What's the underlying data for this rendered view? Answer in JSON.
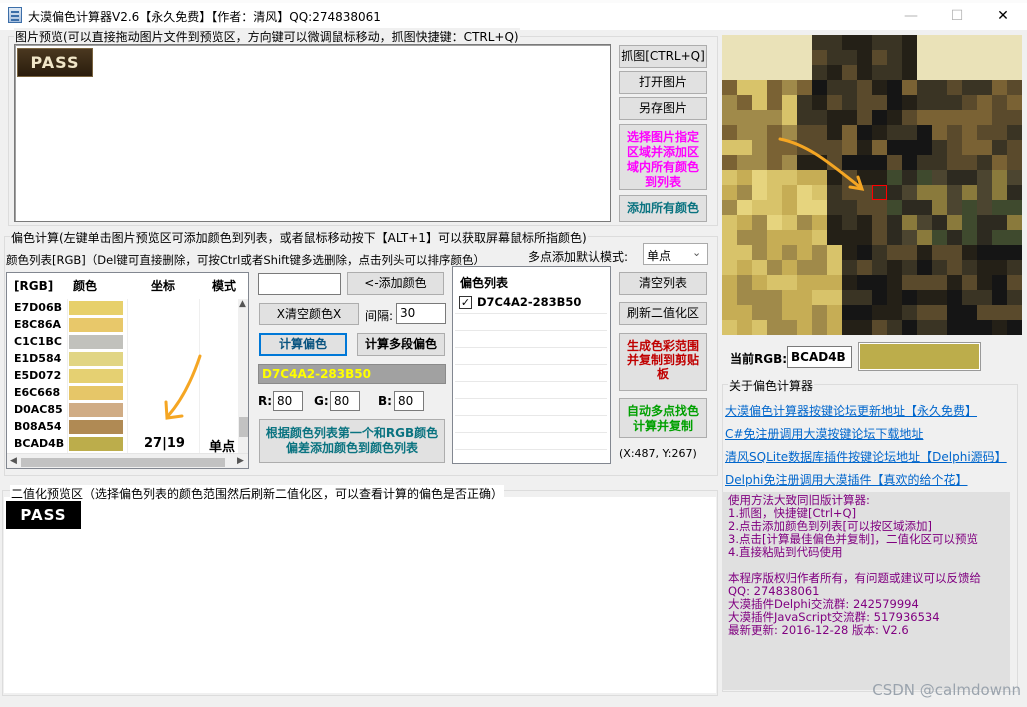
{
  "window": {
    "title": "大漠偏色计算器V2.6【永久免费】【作者：清风】QQ:274838061",
    "min_icon": "—",
    "max_icon": "☐",
    "close_icon": "✕"
  },
  "preview": {
    "group_label": "图片预览(可以直接拖动图片文件到预览区，方向键可以微调鼠标移动，抓图快捷键：CTRL+Q)",
    "image_text": "PASS"
  },
  "right_buttons": {
    "capture": "抓图[CTRL+Q]",
    "open": "打开图片",
    "save_as": "另存图片",
    "select_region": "选择图片指定区域并添加区域内所有颜色到列表",
    "add_all": "添加所有颜色"
  },
  "calc": {
    "group_label": "偏色计算(左键单击图片预览区可添加颜色到列表，或者鼠标移动按下【ALT+1】可以获取屏幕鼠标所指颜色)",
    "list_label": "颜色列表[RGB]（Del键可直接删除，可按Ctrl或者Shift键多选删除，点击列头可以排序颜色）",
    "multi_mode_label": "多点添加默认模式:",
    "multi_mode_value": "单点",
    "columns": [
      "[RGB]",
      "颜色",
      "坐标",
      "模式"
    ],
    "rows": [
      {
        "code": "E7D06B",
        "color": "#e7d06b",
        "coord": "",
        "mode": ""
      },
      {
        "code": "E8C86A",
        "color": "#e8c86a",
        "coord": "",
        "mode": ""
      },
      {
        "code": "C1C1BC",
        "color": "#c1c1bc",
        "coord": "",
        "mode": ""
      },
      {
        "code": "E1D584",
        "color": "#e1d584",
        "coord": "",
        "mode": ""
      },
      {
        "code": "E5D072",
        "color": "#e5d072",
        "coord": "",
        "mode": ""
      },
      {
        "code": "E6C668",
        "color": "#e6c668",
        "coord": "",
        "mode": ""
      },
      {
        "code": "D0AC85",
        "color": "#d0ac85",
        "coord": "",
        "mode": ""
      },
      {
        "code": "B08A54",
        "color": "#b08a54",
        "coord": "",
        "mode": ""
      },
      {
        "code": "BCAD4B",
        "color": "#bcad4b",
        "coord": "27|19",
        "mode": "单点"
      }
    ],
    "add_color_input": "",
    "add_color_btn": "<-添加颜色",
    "clear_color_btn": "X清空颜色X",
    "interval_label": "间隔:",
    "interval_value": "30",
    "calc_btn": "计算偏色",
    "calc_multi_btn": "计算多段偏色",
    "result_value": "D7C4A2-283B50",
    "r_label": "R:",
    "r_value": "80",
    "g_label": "G:",
    "g_value": "80",
    "b_label": "B:",
    "b_value": "80",
    "by_first_btn": "根据颜色列表第一个和RGB颜色偏差添加颜色到颜色列表",
    "color_list_header": "偏色列表",
    "color_list_items": [
      {
        "text": "D7C4A2-283B50",
        "checked": true
      }
    ],
    "clear_list_btn": "清空列表",
    "refresh_bin_btn": "刷新二值化区",
    "gen_range_btn": "生成色彩范围并复制到剪贴板",
    "auto_multi_btn": "自动多点找色计算并复制",
    "mouse_coord": "(X:487, Y:267)"
  },
  "current": {
    "label": "当前RGB:",
    "value": "BCAD4B",
    "color": "#bcad4b"
  },
  "about": {
    "group_label": "关于偏色计算器",
    "links": [
      "大漠偏色计算器按键论坛更新地址【永久免费】",
      "C#免注册调用大漠按键论坛下载地址",
      "清风SQLite数据库插件按键论坛地址【Delphi源码】",
      "Delphi免注册调用大漠插件【真欢的给个花】"
    ],
    "usage": [
      "使用方法大致同旧版计算器:",
      "1.抓图，快捷键[Ctrl+Q]",
      "2.点击添加颜色到列表[可以按区域添加]",
      "3.点击[计算最佳偏色并复制]，二值化区可以预览",
      "4.直接粘贴到代码使用",
      "",
      "本程序版权归作者所有，有问题或建议可以反馈给",
      "QQ: 274838061",
      "大漠插件Delphi交流群: 242579994",
      "大漠插件JavaScript交流群: 517936534",
      "最新更新: 2016-12-28 版本: V2.6"
    ]
  },
  "binarize": {
    "group_label": "二值化预览区（选择偏色列表的颜色范围然后刷新二值化区，可以查看计算的偏色是否正确）",
    "image_text": "PASS"
  },
  "watermark": "CSDN @calmdownn",
  "colors": {
    "accent_blue": "#0078d7",
    "magenta": "#ff00ff",
    "teal": "#0a7380",
    "red": "#c00000",
    "green": "#00a000",
    "link": "#0066cc",
    "annotation": "#f5a623"
  }
}
